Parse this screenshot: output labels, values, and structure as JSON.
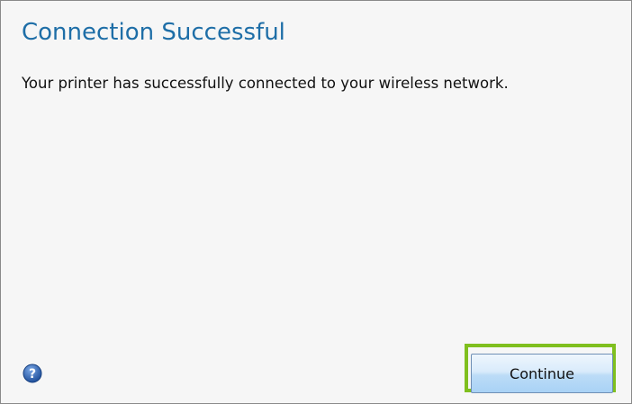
{
  "dialog": {
    "title": "Connection Successful",
    "message": "Your printer has successfully connected to your wireless network.",
    "continue_label": "Continue",
    "help_icon": "help-icon",
    "colors": {
      "title": "#1e6ea7",
      "focus_ring": "#7fbf1e",
      "help_icon": "#2f5fa8"
    }
  }
}
